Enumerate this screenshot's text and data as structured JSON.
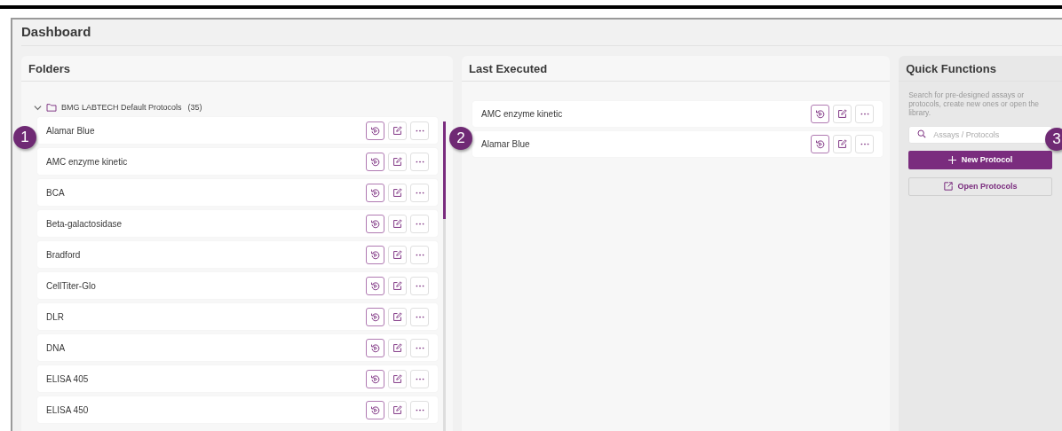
{
  "page_title": "Dashboard",
  "folders": {
    "title": "Folders",
    "group": {
      "name": "BMG LABTECH Default Protocols",
      "count": "(35)",
      "expanded": true,
      "items": [
        {
          "name": "Alamar Blue"
        },
        {
          "name": "AMC enzyme kinetic"
        },
        {
          "name": "BCA"
        },
        {
          "name": "Beta-galactosidase"
        },
        {
          "name": "Bradford"
        },
        {
          "name": "CellTiter-Glo"
        },
        {
          "name": "DLR"
        },
        {
          "name": "DNA"
        },
        {
          "name": "ELISA 405"
        },
        {
          "name": "ELISA 450"
        }
      ]
    }
  },
  "last_executed": {
    "title": "Last Executed",
    "items": [
      {
        "name": "AMC enzyme kinetic"
      },
      {
        "name": "Alamar Blue"
      }
    ]
  },
  "quick_functions": {
    "title": "Quick Functions",
    "description": "Search for pre-designed assays or protocols, create new ones or open the library.",
    "search": {
      "placeholder": "Assays / Protocols"
    },
    "buttons": [
      {
        "label": "New Protocol",
        "kind": "primary"
      },
      {
        "label": "Open Protocols",
        "kind": "secondary"
      }
    ]
  },
  "callouts": [
    "1",
    "2",
    "3"
  ]
}
